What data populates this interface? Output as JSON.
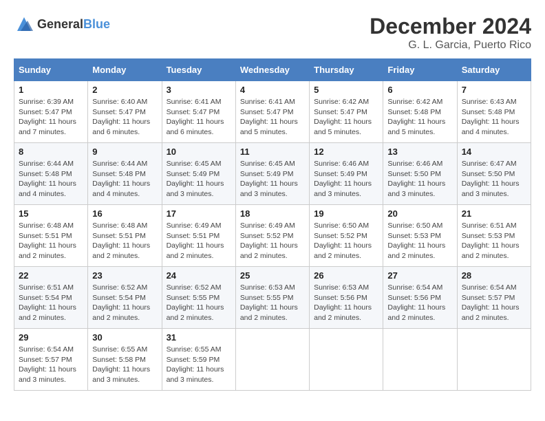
{
  "logo": {
    "text_general": "General",
    "text_blue": "Blue"
  },
  "header": {
    "month_title": "December 2024",
    "location": "G. L. Garcia, Puerto Rico"
  },
  "weekdays": [
    "Sunday",
    "Monday",
    "Tuesday",
    "Wednesday",
    "Thursday",
    "Friday",
    "Saturday"
  ],
  "weeks": [
    [
      {
        "day": "1",
        "info": "Sunrise: 6:39 AM\nSunset: 5:47 PM\nDaylight: 11 hours and 7 minutes."
      },
      {
        "day": "2",
        "info": "Sunrise: 6:40 AM\nSunset: 5:47 PM\nDaylight: 11 hours and 6 minutes."
      },
      {
        "day": "3",
        "info": "Sunrise: 6:41 AM\nSunset: 5:47 PM\nDaylight: 11 hours and 6 minutes."
      },
      {
        "day": "4",
        "info": "Sunrise: 6:41 AM\nSunset: 5:47 PM\nDaylight: 11 hours and 5 minutes."
      },
      {
        "day": "5",
        "info": "Sunrise: 6:42 AM\nSunset: 5:47 PM\nDaylight: 11 hours and 5 minutes."
      },
      {
        "day": "6",
        "info": "Sunrise: 6:42 AM\nSunset: 5:48 PM\nDaylight: 11 hours and 5 minutes."
      },
      {
        "day": "7",
        "info": "Sunrise: 6:43 AM\nSunset: 5:48 PM\nDaylight: 11 hours and 4 minutes."
      }
    ],
    [
      {
        "day": "8",
        "info": "Sunrise: 6:44 AM\nSunset: 5:48 PM\nDaylight: 11 hours and 4 minutes."
      },
      {
        "day": "9",
        "info": "Sunrise: 6:44 AM\nSunset: 5:48 PM\nDaylight: 11 hours and 4 minutes."
      },
      {
        "day": "10",
        "info": "Sunrise: 6:45 AM\nSunset: 5:49 PM\nDaylight: 11 hours and 3 minutes."
      },
      {
        "day": "11",
        "info": "Sunrise: 6:45 AM\nSunset: 5:49 PM\nDaylight: 11 hours and 3 minutes."
      },
      {
        "day": "12",
        "info": "Sunrise: 6:46 AM\nSunset: 5:49 PM\nDaylight: 11 hours and 3 minutes."
      },
      {
        "day": "13",
        "info": "Sunrise: 6:46 AM\nSunset: 5:50 PM\nDaylight: 11 hours and 3 minutes."
      },
      {
        "day": "14",
        "info": "Sunrise: 6:47 AM\nSunset: 5:50 PM\nDaylight: 11 hours and 3 minutes."
      }
    ],
    [
      {
        "day": "15",
        "info": "Sunrise: 6:48 AM\nSunset: 5:51 PM\nDaylight: 11 hours and 2 minutes."
      },
      {
        "day": "16",
        "info": "Sunrise: 6:48 AM\nSunset: 5:51 PM\nDaylight: 11 hours and 2 minutes."
      },
      {
        "day": "17",
        "info": "Sunrise: 6:49 AM\nSunset: 5:51 PM\nDaylight: 11 hours and 2 minutes."
      },
      {
        "day": "18",
        "info": "Sunrise: 6:49 AM\nSunset: 5:52 PM\nDaylight: 11 hours and 2 minutes."
      },
      {
        "day": "19",
        "info": "Sunrise: 6:50 AM\nSunset: 5:52 PM\nDaylight: 11 hours and 2 minutes."
      },
      {
        "day": "20",
        "info": "Sunrise: 6:50 AM\nSunset: 5:53 PM\nDaylight: 11 hours and 2 minutes."
      },
      {
        "day": "21",
        "info": "Sunrise: 6:51 AM\nSunset: 5:53 PM\nDaylight: 11 hours and 2 minutes."
      }
    ],
    [
      {
        "day": "22",
        "info": "Sunrise: 6:51 AM\nSunset: 5:54 PM\nDaylight: 11 hours and 2 minutes."
      },
      {
        "day": "23",
        "info": "Sunrise: 6:52 AM\nSunset: 5:54 PM\nDaylight: 11 hours and 2 minutes."
      },
      {
        "day": "24",
        "info": "Sunrise: 6:52 AM\nSunset: 5:55 PM\nDaylight: 11 hours and 2 minutes."
      },
      {
        "day": "25",
        "info": "Sunrise: 6:53 AM\nSunset: 5:55 PM\nDaylight: 11 hours and 2 minutes."
      },
      {
        "day": "26",
        "info": "Sunrise: 6:53 AM\nSunset: 5:56 PM\nDaylight: 11 hours and 2 minutes."
      },
      {
        "day": "27",
        "info": "Sunrise: 6:54 AM\nSunset: 5:56 PM\nDaylight: 11 hours and 2 minutes."
      },
      {
        "day": "28",
        "info": "Sunrise: 6:54 AM\nSunset: 5:57 PM\nDaylight: 11 hours and 2 minutes."
      }
    ],
    [
      {
        "day": "29",
        "info": "Sunrise: 6:54 AM\nSunset: 5:57 PM\nDaylight: 11 hours and 3 minutes."
      },
      {
        "day": "30",
        "info": "Sunrise: 6:55 AM\nSunset: 5:58 PM\nDaylight: 11 hours and 3 minutes."
      },
      {
        "day": "31",
        "info": "Sunrise: 6:55 AM\nSunset: 5:59 PM\nDaylight: 11 hours and 3 minutes."
      },
      null,
      null,
      null,
      null
    ]
  ]
}
